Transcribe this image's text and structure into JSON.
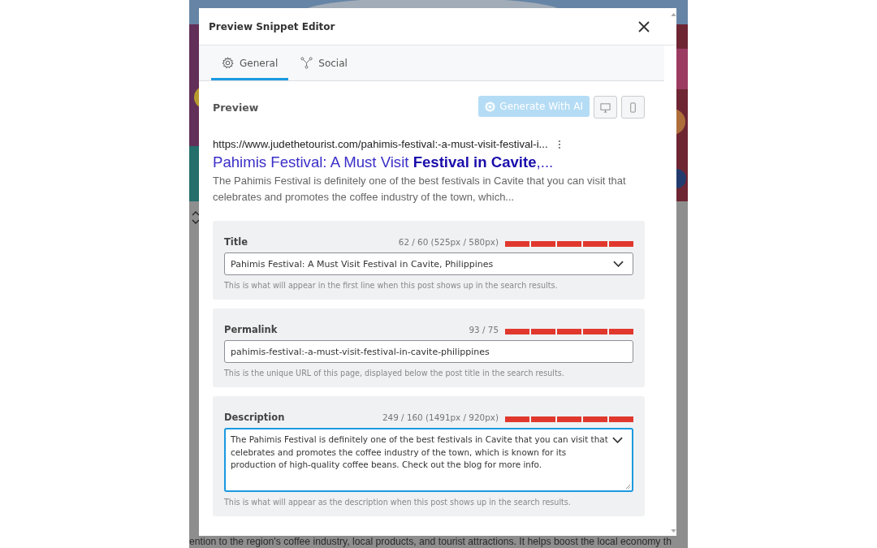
{
  "window": {
    "title": "Preview Snippet Editor"
  },
  "tabs": [
    {
      "label": "General",
      "kind": "gear",
      "selected": true
    },
    {
      "label": "Social",
      "kind": "share",
      "selected": false
    }
  ],
  "preview": {
    "heading": "Preview",
    "generate_button": {
      "label": "Generate With AI",
      "disabled": true
    },
    "view_buttons": [
      {
        "kind": "desktop"
      },
      {
        "kind": "mobile"
      }
    ]
  },
  "snippet": {
    "url": "https://www.judethetourist.com/pahimis-festival:-a-must-visit-festival-i...",
    "title": "Pahimis Festival: A Must Visit **Festival in Cavite**,...",
    "description": "The Pahimis Festival is definitely one of the best festivals in Cavite that you can visit that celebrates and promotes the coffee industry of the town, which..."
  },
  "fields": [
    {
      "kind": "select",
      "label": "Title",
      "count": "62 / 60 (525px / 580px)",
      "level": 1,
      "value": "Pahimis Festival: A Must Visit Festival in Cavite, Philippines",
      "help": "This is what will appear in the first line when this post shows up in the search results.",
      "focused": false
    },
    {
      "kind": "input",
      "label": "Permalink",
      "count": "93 / 75",
      "level": 1,
      "value": "pahimis-festival:-a-must-visit-festival-in-cavite-philippines",
      "help": "This is the unique URL of this page, displayed below the post title in the search results.",
      "focused": false
    },
    {
      "kind": "textarea",
      "label": "Description",
      "count": "249 / 160 (1491px / 920px)",
      "level": 1,
      "value": "The Pahimis Festival is definitely one of the best festivals in Cavite that you can visit that celebrates and promotes the coffee industry of the town, which is known for its production of high-quality coffee beans. Check out the blog for more info.",
      "help": "This is what will appear as the description when this post shows up in the search results.",
      "focused": true
    }
  ],
  "background": {
    "text": "ention to the region's coffee industry, local products, and tourist attractions. It helps boost the local economy th"
  }
}
